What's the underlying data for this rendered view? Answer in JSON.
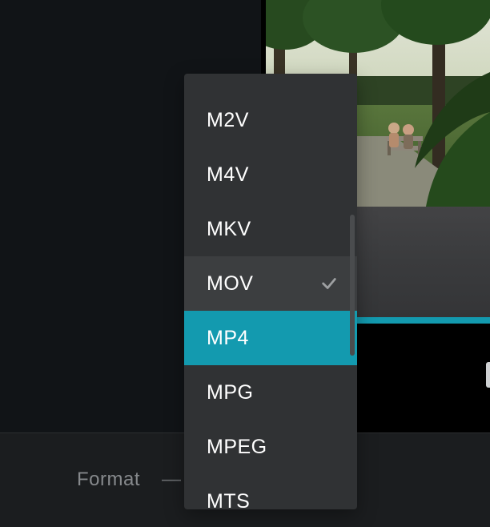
{
  "format_label": "Format",
  "format_dash": "—",
  "dropdown": {
    "items": [
      {
        "label": "M2V"
      },
      {
        "label": "M4V"
      },
      {
        "label": "MKV"
      },
      {
        "label": "MOV"
      },
      {
        "label": "MP4"
      },
      {
        "label": "MPG"
      },
      {
        "label": "MPEG"
      },
      {
        "label": "MTS"
      }
    ],
    "hovered_index": 3,
    "selected_index": 4
  }
}
